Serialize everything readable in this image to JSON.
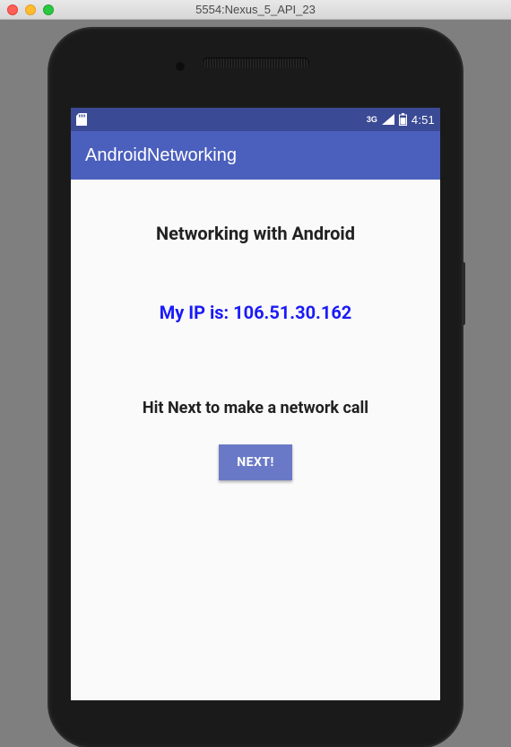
{
  "window": {
    "title": "5554:Nexus_5_API_23"
  },
  "statusbar": {
    "network_label": "3G",
    "time": "4:51"
  },
  "appbar": {
    "title": "AndroidNetworking"
  },
  "main": {
    "heading": "Networking with Android",
    "ip_line": "My IP is: 106.51.30.162",
    "hint": "Hit Next to make a network call",
    "next_button": "NEXT!"
  }
}
